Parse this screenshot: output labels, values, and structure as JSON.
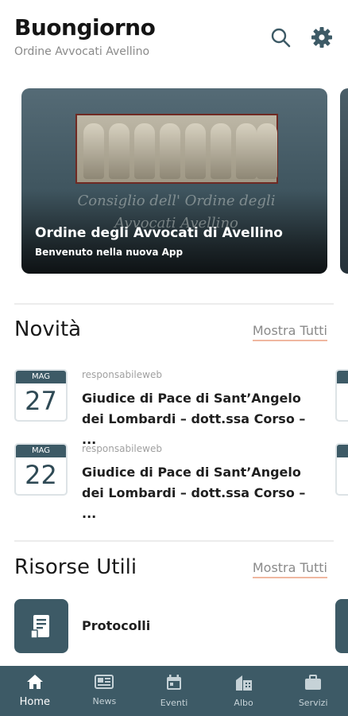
{
  "header": {
    "greeting": "Buongiorno",
    "subtitle": "Ordine Avvocati Avellino",
    "icons": [
      "search-icon",
      "gear-icon"
    ]
  },
  "hero": {
    "watermark": "Consiglio dell' Ordine degli Avvocati Avellino",
    "title": "Ordine degli Avvocati di Avellino",
    "subtitle": "Benvenuto nella nuova App"
  },
  "news": {
    "title": "Novità",
    "show_all": "Mostra Tutti",
    "items": [
      {
        "month": "MAG",
        "day": "27",
        "author": "responsabileweb",
        "title": "Giudice di Pace di Sant’Angelo dei Lombardi – dott.ssa Corso – ..."
      },
      {
        "month": "MAG",
        "day": "22",
        "author": "responsabileweb",
        "title": "Giudice di Pace di Sant’Angelo dei Lombardi – dott.ssa Corso – ..."
      }
    ]
  },
  "resources": {
    "title": "Risorse Utili",
    "show_all": "Mostra Tutti",
    "items": [
      {
        "label": "Protocolli",
        "icon": "document-icon"
      }
    ]
  },
  "nav": {
    "items": [
      {
        "label": "Home",
        "icon": "home-icon",
        "active": true
      },
      {
        "label": "News",
        "icon": "newspaper-icon"
      },
      {
        "label": "Eventi",
        "icon": "calendar-icon"
      },
      {
        "label": "Albo",
        "icon": "building-icon"
      },
      {
        "label": "Servizi",
        "icon": "briefcase-icon"
      }
    ]
  },
  "colors": {
    "primary": "#3d5a66",
    "accent_underline": "#f0b7a0"
  }
}
